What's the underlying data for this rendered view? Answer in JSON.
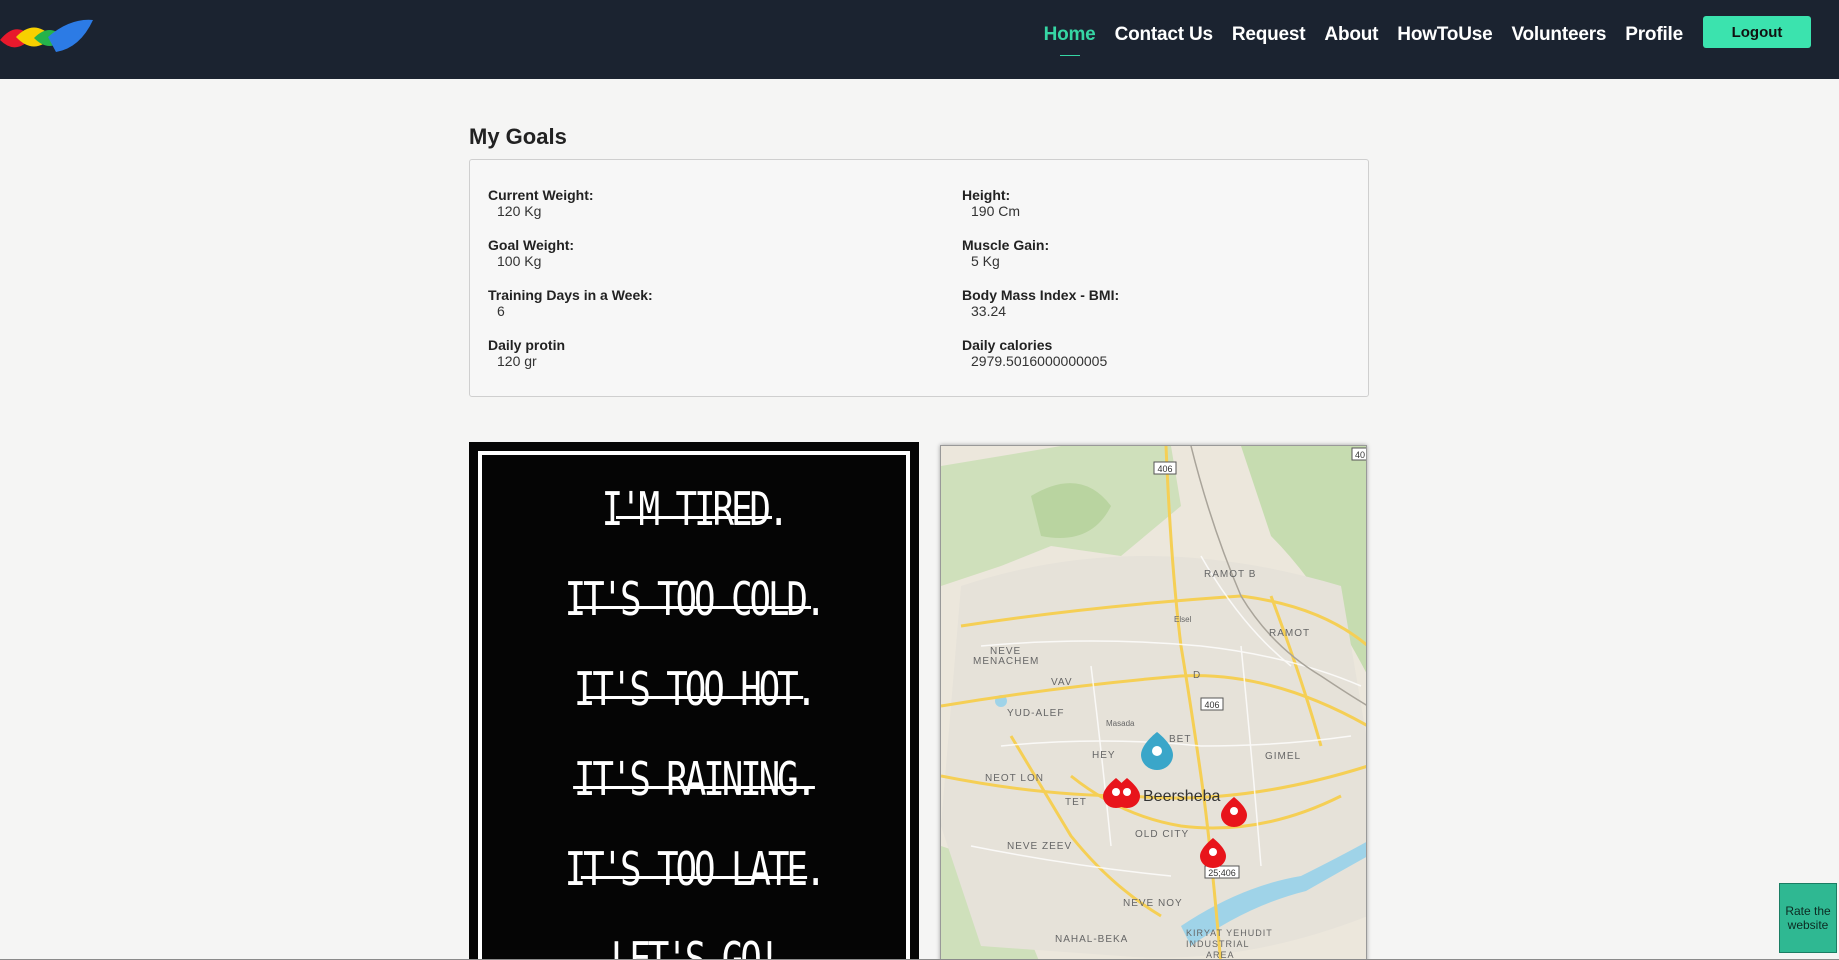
{
  "nav": {
    "items": [
      {
        "label": "Home",
        "active": true
      },
      {
        "label": "Contact Us"
      },
      {
        "label": "Request"
      },
      {
        "label": "About"
      },
      {
        "label": "HowToUse"
      },
      {
        "label": "Volunteers"
      },
      {
        "label": "Profile"
      }
    ],
    "logout_label": "Logout"
  },
  "goals": {
    "title": "My Goals",
    "fields": [
      {
        "label": "Current Weight:",
        "value": "120 Kg"
      },
      {
        "label": "Height:",
        "value": "190 Cm"
      },
      {
        "label": "Goal Weight:",
        "value": "100 Kg"
      },
      {
        "label": "Muscle Gain:",
        "value": "5 Kg"
      },
      {
        "label": "Training Days in a Week:",
        "value": "6"
      },
      {
        "label": "Body Mass Index - BMI:",
        "value": "33.24"
      },
      {
        "label": "Daily protin",
        "value": "120 gr"
      },
      {
        "label": "Daily calories",
        "value": "2979.5016000000005"
      }
    ]
  },
  "quote_image": {
    "lines": [
      "I'M TIRED.",
      "IT'S TOO COLD.",
      "IT'S TOO HOT.",
      "IT'S RAINING.",
      "IT'S TOO LATE.",
      "LET'S GO!"
    ]
  },
  "map": {
    "city_label": "Beersheba",
    "area_labels": [
      "RAMOT B",
      "RAMOT",
      "NEVE MENACHEM",
      "VAV",
      "D",
      "YUD-ALEF",
      "BET",
      "HEY",
      "GIMEL",
      "NEOT LON",
      "TET",
      "OLD CITY",
      "NEVE ZEEV",
      "NEVE NOY",
      "NAHAL-BEKA",
      "KIRYAT YEHUDIT INDUSTRIAL AREA",
      "Masada",
      "Elsel"
    ],
    "road_labels": [
      "406",
      "406",
      "25;406",
      "40"
    ],
    "colors": {
      "land": "#ece7dc",
      "park": "#c6dcb0",
      "water": "#9fd3e8",
      "road": "#f5cf55",
      "marker_red": "#e8141b",
      "marker_blue": "#3aa6c9"
    }
  },
  "rate_button": {
    "label": "Rate the website"
  },
  "colors": {
    "navbar": "#1b2330",
    "accent": "#3be3ae",
    "active_nav": "#36d6a4",
    "page_bg": "#f5f5f4"
  }
}
